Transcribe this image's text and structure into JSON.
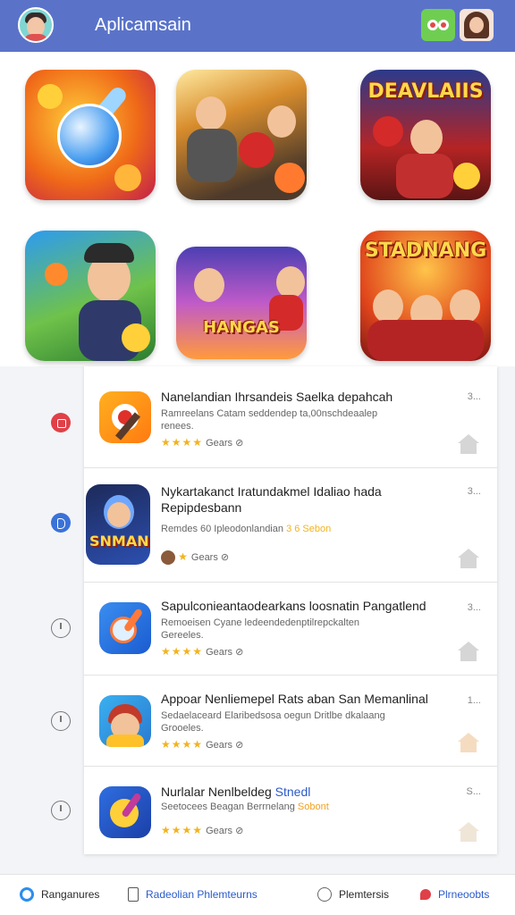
{
  "header": {
    "title": "Aplicamsain",
    "chat_icon": "chat-bubbles-icon",
    "profile_icon": "user-avatar-icon",
    "brand_color": "#5a73c9"
  },
  "featured": {
    "tiles": [
      {
        "title": ""
      },
      {
        "title": ""
      },
      {
        "title": "DEAVLAIIS"
      },
      {
        "title": ""
      },
      {
        "title": "HANGAS"
      },
      {
        "title": "STADNANG"
      }
    ]
  },
  "list": {
    "items": [
      {
        "title": "Nanelandian Ihrsandeis Saelka depahcah",
        "title2": "",
        "desc1": "Ramreelans Catam seddendep ta,00nschdeaalep",
        "desc2": "renees.",
        "rating_label": "Gears",
        "stars": "★★★★",
        "count": "3...",
        "side_icon": "record-icon"
      },
      {
        "title": "Nykartakanct Iratundakmel Idaliao hada",
        "title2": "Repipdesbann",
        "desc1": "Remdes 60 Ipleodonlandian",
        "desc2": "",
        "rating_label": "Gears",
        "stars": "★",
        "count": "3...",
        "side_icon": "bookmark-icon",
        "extra": "3 6 Sebon"
      },
      {
        "title": "Sapulconieantaodearkans loosnatin Pangatlend",
        "title2": "",
        "desc1": "Remoeisen Cyane ledeendedenptilrepckalten",
        "desc2": "Gereeles.",
        "rating_label": "Gears",
        "stars": "★★★★",
        "count": "3...",
        "side_icon": "clock-icon"
      },
      {
        "title": "Appoar Nenliemepel Rats aban San Memanlinal",
        "title2": "",
        "desc1": "Sedaelaceard Elaribedsosa oegun Dritlbe dkalaang",
        "desc2": "Grooeles.",
        "rating_label": "Gears",
        "stars": "★★★★",
        "count": "1...",
        "side_icon": "clock-icon"
      },
      {
        "title": "Nurlalar Nenlbeldeg",
        "title_accent": "Stnedl",
        "title2": "",
        "desc1": "Seetocees Beagan Berrnelang",
        "desc2": "",
        "rating_label": "Gears",
        "stars": "★★★★",
        "count": "S...",
        "side_icon": "clock-icon",
        "extra": "Sobont"
      }
    ]
  },
  "bottom_nav": {
    "items": [
      {
        "label": "Ranganures",
        "icon": "target-icon",
        "color": "#2a2a2a"
      },
      {
        "label": "Radeolian Phlemteurns",
        "icon": "tablet-icon",
        "color": "#2a5ac9"
      },
      {
        "label": "Plemtersis",
        "icon": "smile-icon",
        "color": "#2a2a2a"
      },
      {
        "label": "Plrneoobts",
        "icon": "pin-icon",
        "color": "#2a5ac9"
      }
    ]
  }
}
